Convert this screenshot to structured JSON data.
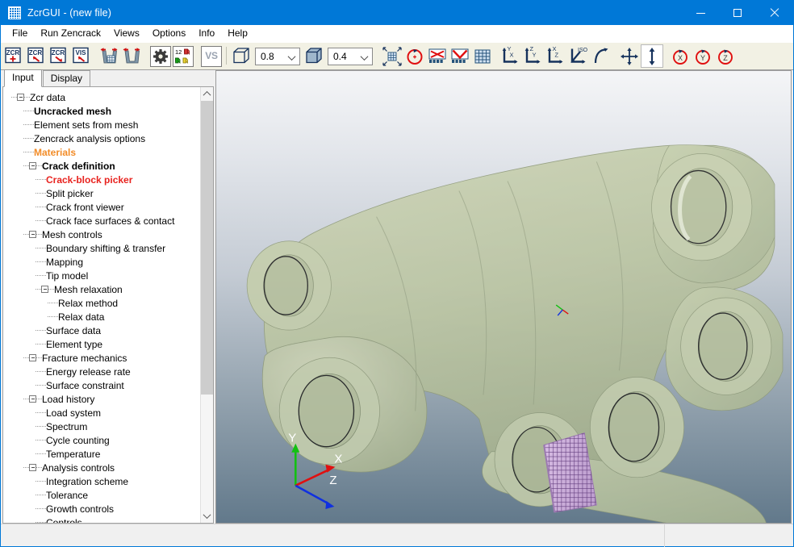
{
  "window": {
    "title": "ZcrGUI - (new file)",
    "icon": "grid-icon",
    "minimize_label": "Minimize",
    "maximize_label": "Maximize",
    "close_label": "Close"
  },
  "menubar": {
    "items": [
      {
        "label": "File"
      },
      {
        "label": "Run Zencrack"
      },
      {
        "label": "Views"
      },
      {
        "label": "Options"
      },
      {
        "label": "Info"
      },
      {
        "label": "Help"
      }
    ]
  },
  "toolbar": {
    "buttons": [
      {
        "name": "new-zcr-button",
        "icon": "zcr-plus-icon",
        "text": "ZCR",
        "enabled": true
      },
      {
        "name": "open-zcr-button",
        "icon": "zcr-open-icon",
        "text": "ZCR",
        "enabled": true
      },
      {
        "name": "save-zcr-button",
        "icon": "zcr-save-icon",
        "text": "ZCR",
        "enabled": true
      },
      {
        "name": "vis-button",
        "icon": "vis-open-icon",
        "text": "VIS",
        "enabled": true
      },
      {
        "name": "import-mesh-button",
        "icon": "mesh-import-icon",
        "text": "",
        "enabled": true
      },
      {
        "name": "export-mesh-button",
        "icon": "mesh-export-icon",
        "text": "",
        "enabled": true
      },
      {
        "name": "settings-button",
        "icon": "gear-icon",
        "text": "",
        "enabled": true
      },
      {
        "name": "crack-block-library-button",
        "icon": "blocks-12-icon",
        "text": "12",
        "enabled": true
      },
      {
        "name": "vs-button",
        "icon": "vs-icon",
        "text": "VS",
        "enabled": false
      }
    ],
    "transparency": {
      "wireframe_box_name": "wireframe-box-icon",
      "wireframe_value": "0.8",
      "solid_box_name": "solid-box-icon",
      "solid_value": "0.4"
    },
    "view_buttons": [
      {
        "name": "zoom-fit-button",
        "icon": "zoom-fit-icon"
      },
      {
        "name": "reset-view-button",
        "icon": "reset-rotate-icon"
      },
      {
        "name": "hide-elements-button",
        "icon": "elements-hide-icon"
      },
      {
        "name": "show-elements-button",
        "icon": "elements-show-icon"
      },
      {
        "name": "mesh-display-button",
        "icon": "mesh-grid-icon"
      },
      {
        "name": "view-yx-button",
        "icon": "axis-yx-icon",
        "label": "Y X"
      },
      {
        "name": "view-zy-button",
        "icon": "axis-zy-icon",
        "label": "Z Y"
      },
      {
        "name": "view-xz-button",
        "icon": "axis-xz-icon",
        "label": "X Z"
      },
      {
        "name": "view-iso-button",
        "icon": "axis-iso-icon",
        "label": "ISO"
      },
      {
        "name": "arc-rotate-button",
        "icon": "arc-icon"
      },
      {
        "name": "pan-button",
        "icon": "pan-arrows-icon"
      },
      {
        "name": "zoom-axis-button",
        "icon": "vertical-arrow-icon",
        "active": true
      },
      {
        "name": "rotate-x-button",
        "icon": "rotate-x-icon",
        "label": "X"
      },
      {
        "name": "rotate-y-button",
        "icon": "rotate-y-icon",
        "label": "Y"
      },
      {
        "name": "rotate-z-button",
        "icon": "rotate-z-icon",
        "label": "Z"
      }
    ]
  },
  "panel": {
    "tabs": [
      {
        "label": "Input",
        "selected": true
      },
      {
        "label": "Display",
        "selected": false
      }
    ],
    "tree": [
      {
        "label": "Zcr data",
        "depth": 0,
        "expander": true,
        "style": "normal"
      },
      {
        "label": "Uncracked mesh",
        "depth": 1,
        "expander": false,
        "style": "bold"
      },
      {
        "label": "Element sets from mesh",
        "depth": 1,
        "expander": false,
        "style": "normal"
      },
      {
        "label": "Zencrack analysis options",
        "depth": 1,
        "expander": false,
        "style": "normal"
      },
      {
        "label": "Materials",
        "depth": 1,
        "expander": false,
        "style": "orange"
      },
      {
        "label": "Crack definition",
        "depth": 1,
        "expander": true,
        "style": "bold"
      },
      {
        "label": "Crack-block picker",
        "depth": 2,
        "expander": false,
        "style": "red"
      },
      {
        "label": "Split picker",
        "depth": 2,
        "expander": false,
        "style": "normal"
      },
      {
        "label": "Crack front viewer",
        "depth": 2,
        "expander": false,
        "style": "normal"
      },
      {
        "label": "Crack face surfaces & contact",
        "depth": 2,
        "expander": false,
        "style": "normal"
      },
      {
        "label": "Mesh controls",
        "depth": 1,
        "expander": true,
        "style": "normal"
      },
      {
        "label": "Boundary shifting & transfer",
        "depth": 2,
        "expander": false,
        "style": "normal"
      },
      {
        "label": "Mapping",
        "depth": 2,
        "expander": false,
        "style": "normal"
      },
      {
        "label": "Tip model",
        "depth": 2,
        "expander": false,
        "style": "normal"
      },
      {
        "label": "Mesh relaxation",
        "depth": 2,
        "expander": true,
        "style": "normal"
      },
      {
        "label": "Relax method",
        "depth": 3,
        "expander": false,
        "style": "normal"
      },
      {
        "label": "Relax data",
        "depth": 3,
        "expander": false,
        "style": "normal"
      },
      {
        "label": "Surface data",
        "depth": 2,
        "expander": false,
        "style": "normal"
      },
      {
        "label": "Element type",
        "depth": 2,
        "expander": false,
        "style": "normal"
      },
      {
        "label": "Fracture mechanics",
        "depth": 1,
        "expander": true,
        "style": "normal"
      },
      {
        "label": "Energy release rate",
        "depth": 2,
        "expander": false,
        "style": "normal"
      },
      {
        "label": "Surface constraint",
        "depth": 2,
        "expander": false,
        "style": "normal"
      },
      {
        "label": "Load history",
        "depth": 1,
        "expander": true,
        "style": "normal"
      },
      {
        "label": "Load system",
        "depth": 2,
        "expander": false,
        "style": "normal"
      },
      {
        "label": "Spectrum",
        "depth": 2,
        "expander": false,
        "style": "normal"
      },
      {
        "label": "Cycle counting",
        "depth": 2,
        "expander": false,
        "style": "normal"
      },
      {
        "label": "Temperature",
        "depth": 2,
        "expander": false,
        "style": "normal"
      },
      {
        "label": "Analysis controls",
        "depth": 1,
        "expander": true,
        "style": "normal"
      },
      {
        "label": "Integration scheme",
        "depth": 2,
        "expander": false,
        "style": "normal"
      },
      {
        "label": "Tolerance",
        "depth": 2,
        "expander": false,
        "style": "normal"
      },
      {
        "label": "Growth controls",
        "depth": 2,
        "expander": false,
        "style": "normal"
      },
      {
        "label": "Controls",
        "depth": 2,
        "expander": false,
        "style": "normal"
      }
    ],
    "scrollbar": {
      "up_name": "scroll-up-arrow",
      "down_name": "scroll-down-arrow",
      "thumb_name": "scroll-thumb"
    }
  },
  "viewport": {
    "name": "model-3d-viewport",
    "model_name": "bracket-component-model",
    "model_color": "#b9c29a",
    "crack_block_color": "#c9a6d8",
    "crack_block_mesh_color": "#5e3a7a",
    "background_top": "#f3f4f6",
    "background_bottom": "#627a8c",
    "axis_triad": {
      "name": "axis-triad",
      "x_label": "X",
      "y_label": "Y",
      "z_label": "Z",
      "x_color": "#e01010",
      "y_color": "#12c012",
      "z_color": "#1030e0"
    },
    "secondary_triad": {
      "name": "secondary-axis-marker"
    }
  },
  "statusbar": {
    "message": "",
    "right_message": ""
  }
}
